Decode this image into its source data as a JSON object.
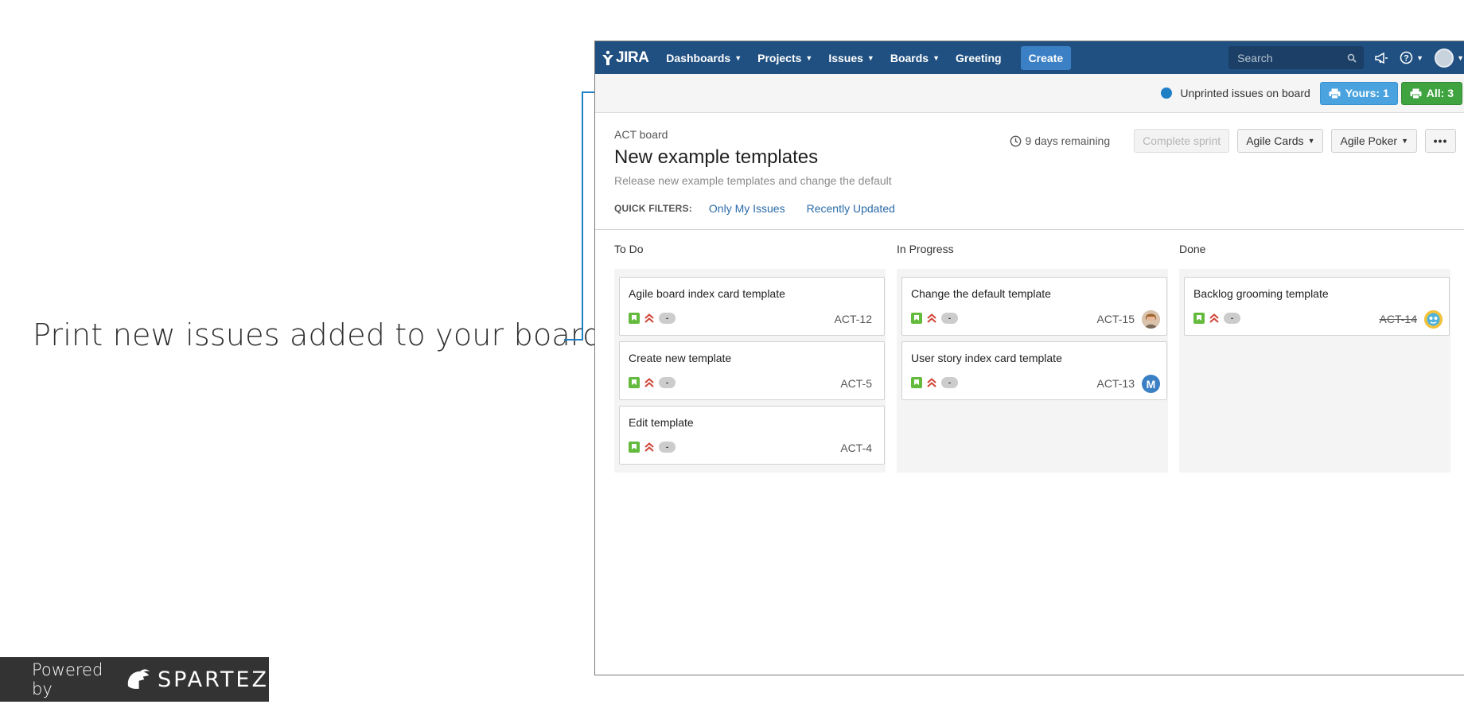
{
  "callout": {
    "text": "Print new issues added to your board"
  },
  "powered_by": {
    "prefix": "Powered by",
    "brand": "SPARTEZ"
  },
  "nav": {
    "logo": "JIRA",
    "menu": [
      {
        "label": "Dashboards",
        "dropdown": true
      },
      {
        "label": "Projects",
        "dropdown": true
      },
      {
        "label": "Issues",
        "dropdown": true
      },
      {
        "label": "Boards",
        "dropdown": true
      },
      {
        "label": "Greeting",
        "dropdown": false
      }
    ],
    "create_label": "Create",
    "search_placeholder": "Search",
    "icons": [
      "search-icon",
      "megaphone-icon",
      "help-icon",
      "user-avatar"
    ]
  },
  "print_bar": {
    "label": "Unprinted issues on board",
    "yours_label": "Yours: 1",
    "all_label": "All: 3",
    "colors": {
      "yours": "#4aa3df",
      "all": "#3fa33f",
      "indicator": "#1f7fc5"
    }
  },
  "header": {
    "breadcrumb": "ACT board",
    "title": "New example templates",
    "goal": "Release new example templates and change the default",
    "remaining": "9 days remaining",
    "complete_sprint": "Complete sprint",
    "agile_cards": "Agile Cards",
    "agile_poker": "Agile Poker",
    "more": "•••"
  },
  "quick_filters": {
    "label": "QUICK FILTERS:",
    "items": [
      "Only My Issues",
      "Recently Updated"
    ]
  },
  "board": {
    "columns": [
      {
        "title": "To Do",
        "cards": [
          {
            "summary": "Agile board index card template",
            "key": "ACT-12",
            "estimate": "-",
            "assignee": null,
            "done": false
          },
          {
            "summary": "Create new template",
            "key": "ACT-5",
            "estimate": "-",
            "assignee": null,
            "done": false
          },
          {
            "summary": "Edit template",
            "key": "ACT-4",
            "estimate": "-",
            "assignee": null,
            "done": false
          }
        ]
      },
      {
        "title": "In Progress",
        "cards": [
          {
            "summary": "Change the default template",
            "key": "ACT-15",
            "estimate": "-",
            "assignee": {
              "type": "photo"
            },
            "done": false
          },
          {
            "summary": "User story index card template",
            "key": "ACT-13",
            "estimate": "-",
            "assignee": {
              "type": "initial",
              "initial": "M",
              "color": "#3b7fc4"
            },
            "done": false
          }
        ]
      },
      {
        "title": "Done",
        "cards": [
          {
            "summary": "Backlog grooming template",
            "key": "ACT-14",
            "estimate": "-",
            "assignee": {
              "type": "emoji",
              "color": "#f2c33d"
            },
            "done": true
          }
        ]
      }
    ],
    "issue_type_icon": "story-icon",
    "priority_icon": "highest-priority-icon",
    "colors": {
      "story": "#63ba3c",
      "priority": "#d04437"
    }
  }
}
